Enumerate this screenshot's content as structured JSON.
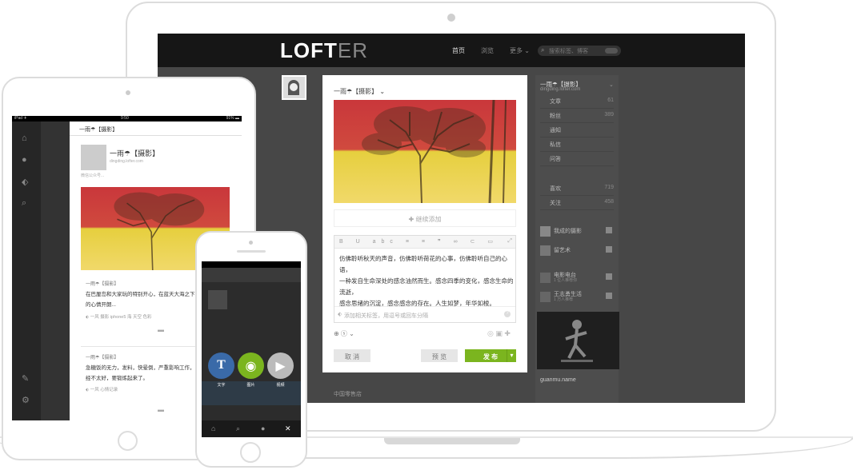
{
  "laptop": {
    "logo_main": "LOFT",
    "logo_tail": "ER",
    "nav": [
      {
        "label": "首页",
        "active": true
      },
      {
        "label": "浏览",
        "active": false
      },
      {
        "label": "更多 ⌄",
        "active": false
      }
    ],
    "search_placeholder": "搜索标签、博客",
    "post_blog": "一雨☂【摄影】",
    "add_more": "✚ 继续添加",
    "toolbar": "B U abc ≡ ≡ ❞ ∞ ⊂ ▭",
    "editor_lines": [
      "仿佛聆听秋天的声音，仿佛聆听荷花的心事，仿佛聆听自己的心语，",
      "一种发自生命深处的感念油然而生。感念四季的变化，感念生命的流逝，",
      "感念思绪的沉淀，感念感念的存在。人生如梦，年华如梭。"
    ],
    "tag_placeholder": "添加相关标签，用逗号或回车分隔",
    "cancel": "取 消",
    "preview": "预 览",
    "publish": "发 布",
    "sidebar": {
      "blog_name": "一雨☂【摄影】",
      "blog_url": "dingding.lofter.com",
      "rows": [
        {
          "label": "文章",
          "num": "61"
        },
        {
          "label": "粉丝",
          "num": "389"
        },
        {
          "label": "通知",
          "num": ""
        },
        {
          "label": "私信",
          "num": ""
        },
        {
          "label": "问答",
          "num": ""
        }
      ],
      "follow_rows": [
        {
          "label": "喜欢",
          "num": "719"
        },
        {
          "label": "关注",
          "num": "458"
        }
      ],
      "recommend": [
        {
          "name": "我成的摄影",
          "sub": ""
        },
        {
          "name": "留艺术",
          "sub": ""
        },
        {
          "name": "电影电台",
          "sub": "1 位人推荐你"
        },
        {
          "name": "王志勇生活",
          "sub": "1 万人推荐"
        }
      ],
      "rec_name": "guanmu.name"
    },
    "bottom_label": "中国零售店"
  },
  "ipad": {
    "status_left": "iPad ✈",
    "status_time": "9:50",
    "status_right": "91% ▬",
    "header_title": "一雨☂【摄影】",
    "blog_name": "一雨☂【摄影】",
    "blog_url": "dingding.lofter.com",
    "blog_sub": "微信公众号...",
    "post1_author": "一雨☂【摄影】",
    "post1_text": "在巴厘岛和大家玩的特别开心，在蓝天大海之下，",
    "post1_text2": "的心情开朗...",
    "post1_tags": "一风  摄影  iphone5  海  天空  色彩",
    "post2_author": "一雨☂【摄影】",
    "post2_text": "急糖饭的无力，发料，快晕倒，严重影响工作，",
    "post2_text2": "经不太好，要锻炼起来了。",
    "post2_tags": "一风  心情记录"
  },
  "iphone": {
    "options": [
      {
        "label": "文字",
        "icon": "T",
        "color": "#3a6aa8"
      },
      {
        "label": "图片",
        "icon": "◉",
        "color": "#7bb51f"
      },
      {
        "label": "视频",
        "icon": "▶",
        "color": "#bbbbbb"
      }
    ]
  }
}
